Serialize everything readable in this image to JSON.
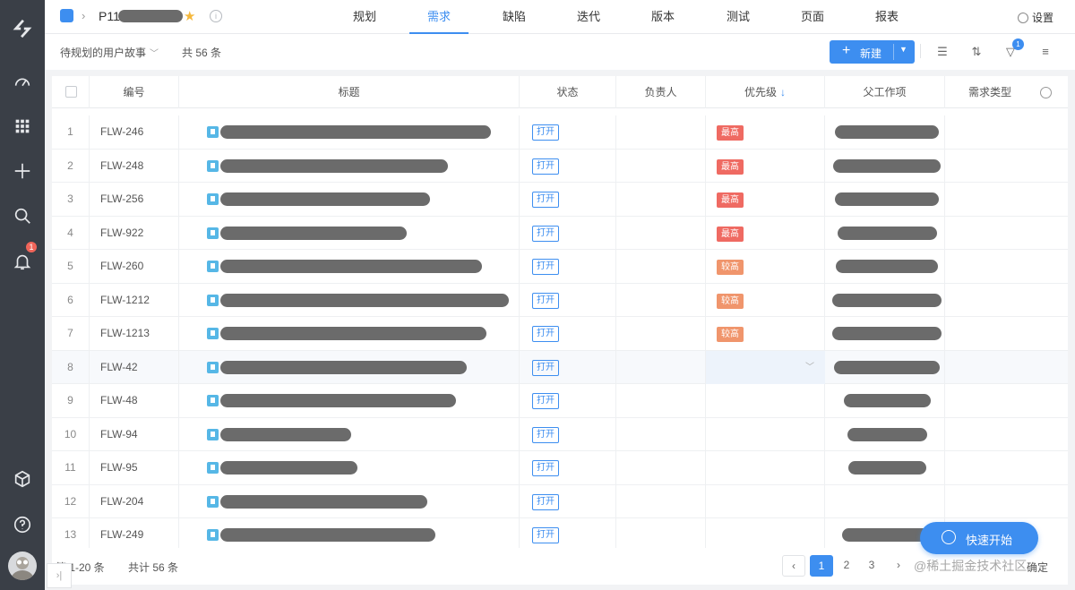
{
  "leftnav": {
    "icons": [
      "logo-icon",
      "dashboard-icon",
      "apps-icon",
      "add-icon",
      "search-icon",
      "bell-icon",
      "cube-icon",
      "help-icon"
    ],
    "notification_count": "1"
  },
  "header": {
    "project_name": "P11",
    "tabs": [
      {
        "label": "规划"
      },
      {
        "label": "需求"
      },
      {
        "label": "缺陷"
      },
      {
        "label": "迭代"
      },
      {
        "label": "版本"
      },
      {
        "label": "测试"
      },
      {
        "label": "页面"
      },
      {
        "label": "报表"
      }
    ],
    "active_tab": "需求",
    "settings_label": "设置"
  },
  "toolbar": {
    "view_label": "待规划的用户故事",
    "total_label": "共 56 条",
    "new_button_label": "新建",
    "filter_badge": "1"
  },
  "table": {
    "columns": [
      "编号",
      "标题",
      "状态",
      "负责人",
      "优先级",
      "父工作项",
      "需求类型"
    ],
    "rows": [
      {
        "num": "1",
        "id": "FLW-246",
        "status": "打开",
        "priority": "最高"
      },
      {
        "num": "2",
        "id": "FLW-248",
        "status": "打开",
        "priority": "最高"
      },
      {
        "num": "3",
        "id": "FLW-256",
        "status": "打开",
        "priority": "最高"
      },
      {
        "num": "4",
        "id": "FLW-922",
        "status": "打开",
        "priority": "最高"
      },
      {
        "num": "5",
        "id": "FLW-260",
        "status": "打开",
        "priority": "较高"
      },
      {
        "num": "6",
        "id": "FLW-1212",
        "status": "打开",
        "priority": "较高"
      },
      {
        "num": "7",
        "id": "FLW-1213",
        "status": "打开",
        "priority": "较高"
      },
      {
        "num": "8",
        "id": "FLW-42",
        "status": "打开",
        "priority": ""
      },
      {
        "num": "9",
        "id": "FLW-48",
        "status": "打开",
        "priority": ""
      },
      {
        "num": "10",
        "id": "FLW-94",
        "status": "打开",
        "priority": ""
      },
      {
        "num": "11",
        "id": "FLW-95",
        "status": "打开",
        "priority": ""
      },
      {
        "num": "12",
        "id": "FLW-204",
        "status": "打开",
        "priority": ""
      },
      {
        "num": "13",
        "id": "FLW-249",
        "status": "打开",
        "priority": ""
      }
    ]
  },
  "footer": {
    "range_label": "第 1-20 条",
    "total_label": "共计 56 条",
    "pages": [
      "1",
      "2",
      "3"
    ],
    "current_page": "1",
    "confirm_label": "确定"
  },
  "quick_start_label": "快速开始",
  "watermark": "@稀土掘金技术社区",
  "colors": {
    "accent": "#3d8ef0",
    "sidebar": "#3a3f47",
    "priority_highest": "#ef6a62",
    "priority_high": "#f0956c"
  }
}
